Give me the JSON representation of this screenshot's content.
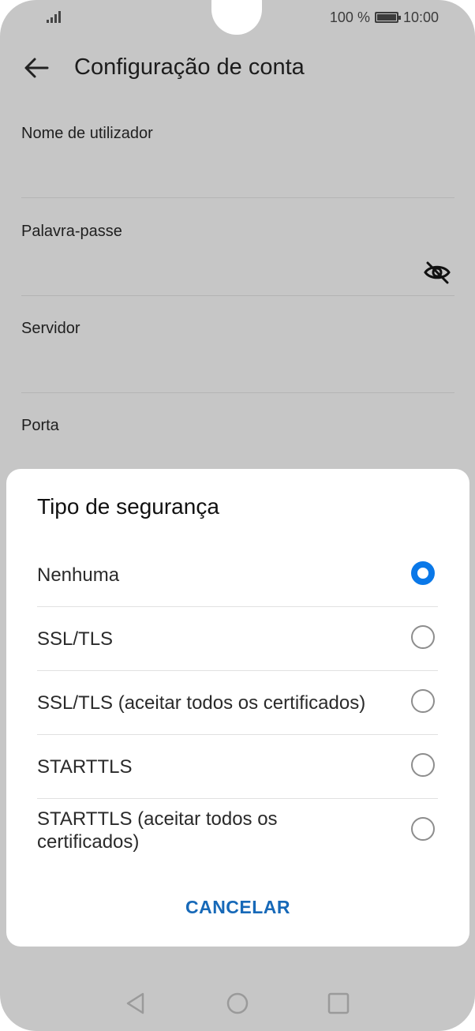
{
  "status": {
    "battery_percent": "100 %",
    "time": "10:00"
  },
  "appbar": {
    "title": "Configuração de conta"
  },
  "fields": [
    {
      "label": "Nome de utilizador"
    },
    {
      "label": "Palavra-passe"
    },
    {
      "label": "Servidor"
    },
    {
      "label": "Porta"
    }
  ],
  "dialog": {
    "title": "Tipo de segurança",
    "options": [
      {
        "label": "Nenhuma",
        "selected": true
      },
      {
        "label": "SSL/TLS",
        "selected": false
      },
      {
        "label": "SSL/TLS (aceitar todos os certificados)",
        "selected": false
      },
      {
        "label": "STARTTLS",
        "selected": false
      },
      {
        "label": "STARTTLS (aceitar todos os certificados)",
        "selected": false
      }
    ],
    "cancel_label": "CANCELAR"
  },
  "colors": {
    "accent": "#0a78e8",
    "cancel": "#1769b8",
    "scrim": "#c6c6c6"
  },
  "icons": [
    "signal-icon",
    "battery-icon",
    "back-arrow-icon",
    "eye-off-icon",
    "nav-back-icon",
    "nav-home-icon",
    "nav-recents-icon"
  ]
}
